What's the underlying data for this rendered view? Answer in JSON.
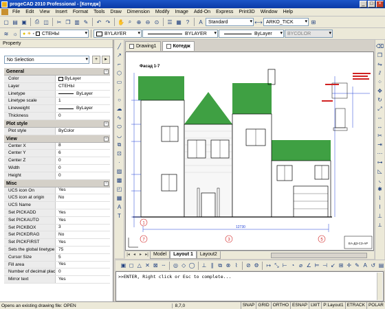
{
  "window": {
    "title": "progeCAD 2010 Professional - [Котедж]",
    "buttons": [
      "_",
      "□",
      "×"
    ]
  },
  "menu": [
    "File",
    "Edit",
    "View",
    "Insert",
    "Format",
    "Tools",
    "Draw",
    "Dimension",
    "Modify",
    "Image",
    "Add-On",
    "Express",
    "Print3D",
    "Window",
    "Help"
  ],
  "toolbar1": {
    "text_style": "Standard",
    "dim_style": "ARKO_TICK"
  },
  "toolbar2": {
    "layer": "СТЕНЫ",
    "color": "BYLAYER",
    "linetype": "BYLAYER",
    "lineweight": "ByLayer",
    "plotstyle": "BYCOLOR"
  },
  "property_panel": {
    "title": "Property",
    "selection": "No Selection",
    "groups": [
      {
        "name": "General",
        "rows": [
          {
            "k": "Color",
            "v": "ByLayer",
            "swatch": true
          },
          {
            "k": "Layer",
            "v": "СТЕНЫ"
          },
          {
            "k": "Linetype",
            "v": "ByLayer",
            "line": true
          },
          {
            "k": "Linetype scale",
            "v": "1"
          },
          {
            "k": "Lineweight",
            "v": "ByLayer",
            "line": true
          },
          {
            "k": "Thickness",
            "v": "0"
          }
        ]
      },
      {
        "name": "Plot style",
        "rows": [
          {
            "k": "Plot style",
            "v": "ByColor"
          }
        ]
      },
      {
        "name": "View",
        "rows": [
          {
            "k": "Center X",
            "v": "8"
          },
          {
            "k": "Center Y",
            "v": "6"
          },
          {
            "k": "Center Z",
            "v": "0"
          },
          {
            "k": "Width",
            "v": "0"
          },
          {
            "k": "Height",
            "v": "0"
          }
        ]
      },
      {
        "name": "Misc",
        "rows": [
          {
            "k": "UCS icon On",
            "v": "Yes"
          },
          {
            "k": "UCS icon at origin",
            "v": "No"
          },
          {
            "k": "UCS Name",
            "v": ""
          },
          {
            "k": "Set PICKADD",
            "v": "Yes"
          },
          {
            "k": "Set PICKAUTO",
            "v": "Yes"
          },
          {
            "k": "Set PICKBOX",
            "v": "3"
          },
          {
            "k": "Set PICKDRAG",
            "v": "No"
          },
          {
            "k": "Set PICKFIRST",
            "v": "Yes"
          },
          {
            "k": "Sets the global linetype ...",
            "v": "75"
          },
          {
            "k": "Cursor Size",
            "v": "5"
          },
          {
            "k": "Fill area",
            "v": "Yes"
          },
          {
            "k": "Number of decimal places",
            "v": "0"
          },
          {
            "k": "Mirror text",
            "v": "Yes"
          }
        ]
      }
    ]
  },
  "drawing_tabs": [
    "Drawing1",
    "Котедж"
  ],
  "layout_tabs": [
    "Model",
    "Layout 1",
    "Layout2"
  ],
  "drawing": {
    "title": "Фасад 1-7",
    "dimension": "12730",
    "stamp": "ЕА-ДЗ-СЗ-АР",
    "axis_labels": [
      "7",
      "1",
      "3",
      "5"
    ]
  },
  "command_line": ">>ENTER, Right click or Esc to complete...",
  "status": {
    "message": "Opens an existing drawing file:  OPEN",
    "coords": "8,7,0",
    "toggles": [
      "SNAP",
      "GRID",
      "ORTHO",
      "ESNAP",
      "LWT",
      "P:Layout1",
      "ETRACK",
      "POLAR"
    ]
  },
  "colors": {
    "roof": "#3fa043",
    "dim": "#1a3cd6",
    "title_bar": "#0a3aa6",
    "red_detail": "#d02020"
  }
}
